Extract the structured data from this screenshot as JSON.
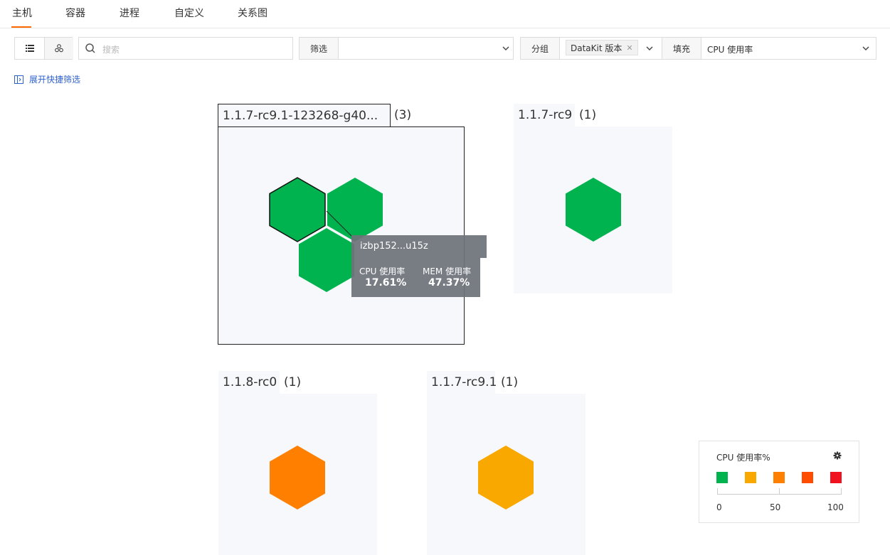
{
  "tabs": [
    "主机",
    "容器",
    "进程",
    "自定义",
    "关系图"
  ],
  "search": {
    "placeholder": "搜索"
  },
  "filter": {
    "label": "筛选",
    "value": ""
  },
  "group": {
    "label": "分组",
    "tag": "DataKit 版本"
  },
  "fill": {
    "label": "填充",
    "value": "CPU 使用率"
  },
  "quick_filter": "展开快捷筛选",
  "groups": [
    {
      "name": "1.1.7-rc9.1-123268-g40...",
      "count": "(3)",
      "hex_colors": [
        "#00b34f",
        "#00b34f",
        "#00b34f"
      ]
    },
    {
      "name": "1.1.7-rc9",
      "count": "(1)",
      "hex_colors": [
        "#00b34f"
      ]
    },
    {
      "name": "1.1.8-rc0",
      "count": "(1)",
      "hex_colors": [
        "#ff8000"
      ]
    },
    {
      "name": "1.1.7-rc9.1",
      "count": "(1)",
      "hex_colors": [
        "#f9a800"
      ]
    }
  ],
  "tooltip": {
    "host": "izbp152...u15z",
    "cpu_label": "CPU 使用率",
    "cpu_value": "17.61%",
    "mem_label": "MEM 使用率",
    "mem_value": "47.37%"
  },
  "legend": {
    "title": "CPU 使用率%",
    "swatches": [
      "#00b34f",
      "#f9a800",
      "#ff8000",
      "#ff4d00",
      "#f0121e"
    ],
    "ticks": [
      "0",
      "50",
      "100"
    ]
  },
  "colors": {
    "accent": "#ff6a00",
    "link": "#2f61cc"
  }
}
